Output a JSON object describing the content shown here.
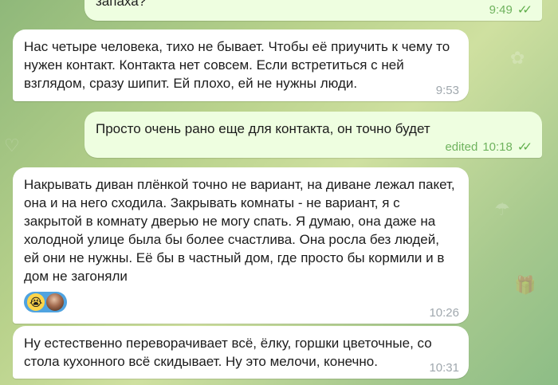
{
  "messages": [
    {
      "id": "m0",
      "type": "outgoing",
      "text": "запаха?",
      "time": "9:49",
      "status": "read"
    },
    {
      "id": "m1",
      "type": "incoming",
      "text": "Нас четыре человека, тихо не бывает. Чтобы её приучить к чему то нужен контакт. Контакта нет совсем. Если встретиться с ней взглядом, сразу шипит. Ей плохо, ей не нужны люди.",
      "time": "9:53"
    },
    {
      "id": "m2",
      "type": "outgoing",
      "text": "Просто очень рано еще для контакта, он точно будет",
      "edited_label": "edited",
      "time": "10:18",
      "status": "read"
    },
    {
      "id": "m3",
      "type": "incoming",
      "text": "Накрывать диван плёнкой точно не вариант, на диване лежал пакет, она и на него сходила. Закрывать комнаты - не вариант, я с закрытой в комнату дверью не могу спать. Я думаю, она даже на холодной улице была бы более счастлива. Она росла без людей, ей они не нужны. Её бы в частный дом, где просто бы кормили и в дом не загоняли",
      "time": "10:26",
      "reaction_emoji": "😭"
    },
    {
      "id": "m4",
      "type": "incoming",
      "text": "Ну естественно переворачивает всё, ёлку, горшки цветочные, со стола кухонного всё скидывает. Ну это мелочи, конечно.",
      "time": "10:31"
    }
  ],
  "colors": {
    "incoming_bubble": "#ffffff",
    "outgoing_bubble": "#eefee0",
    "read_ticks": "#5fae4a",
    "reaction_bg": "#4fa3e0"
  }
}
